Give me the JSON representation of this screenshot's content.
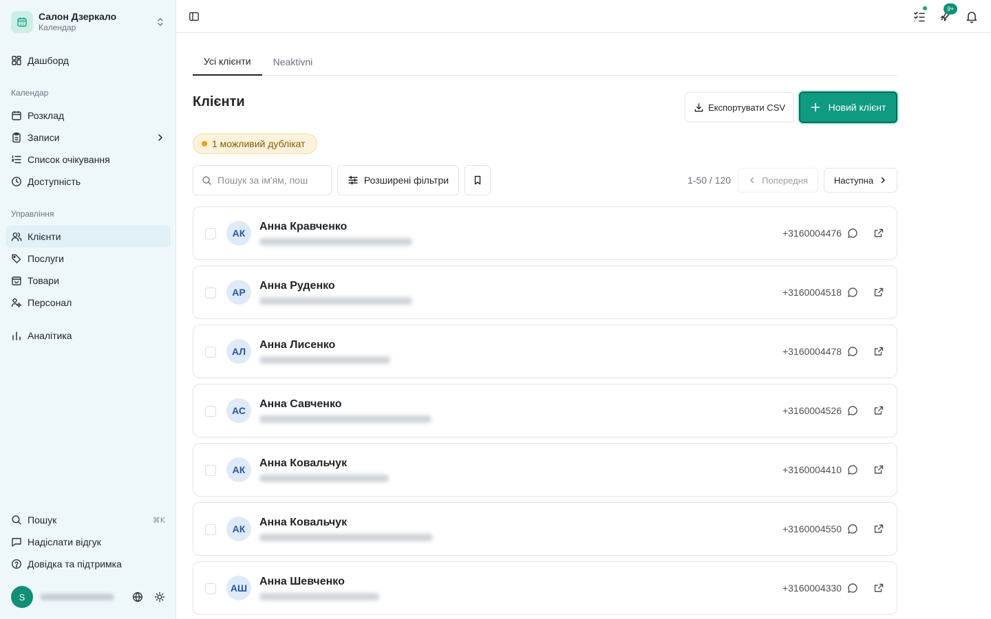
{
  "org": {
    "name": "Салон Дзеркало",
    "subtitle": "Календар"
  },
  "sidebar": {
    "dashboard": "Дашборд",
    "section_calendar": "Календар",
    "calendar_items": [
      "Розклад",
      "Записи",
      "Список очікування",
      "Доступність"
    ],
    "section_management": "Управління",
    "management_items": [
      "Клієнти",
      "Послуги",
      "Товари",
      "Персонал"
    ],
    "analytics": "Аналітика",
    "bottom_items": [
      "Пошук",
      "Надіслати відгук",
      "Довідка та підтримка"
    ],
    "search_shortcut": "⌘K",
    "user_initial": "S"
  },
  "topbar": {
    "notification_badge": "9+"
  },
  "tabs": [
    "Усі клієнти",
    "Neaktivni"
  ],
  "page": {
    "title": "Клієнти",
    "export_label": "Експортувати CSV",
    "new_client_label": "Новий клієнт",
    "duplicate_label": "1 можливий дублікат",
    "search_placeholder": "Пошук за ім'ям, пош",
    "filters_label": "Розширені фільтри",
    "range": "1-50 / 120",
    "prev_label": "Попередня",
    "next_label": "Наступна"
  },
  "clients": [
    {
      "initials": "АК",
      "name": "Анна Кравченко",
      "phone": "+3160004476"
    },
    {
      "initials": "АР",
      "name": "Анна Руденко",
      "phone": "+3160004518"
    },
    {
      "initials": "АЛ",
      "name": "Анна Лисенко",
      "phone": "+3160004478"
    },
    {
      "initials": "АС",
      "name": "Анна Савченко",
      "phone": "+3160004526"
    },
    {
      "initials": "АК",
      "name": "Анна Ковальчук",
      "phone": "+3160004410"
    },
    {
      "initials": "АК",
      "name": "Анна Ковальчук",
      "phone": "+3160004550"
    },
    {
      "initials": "АШ",
      "name": "Анна Шевченко",
      "phone": "+3160004330"
    }
  ],
  "colors": {
    "accent": "#0f9a82",
    "sidebar_bg": "#eef8fb",
    "duplicate_dot": "#f59e0b"
  }
}
